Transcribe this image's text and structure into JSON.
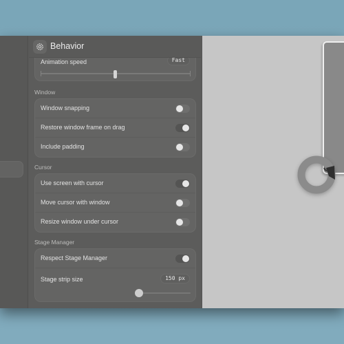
{
  "header": {
    "title": "Behavior",
    "icon": "gear-icon"
  },
  "animation": {
    "label": "Animation speed",
    "value": "Fast",
    "slider_fraction": 0.5
  },
  "sections": [
    {
      "title": "Window",
      "rows": [
        {
          "label": "Window snapping",
          "on": false
        },
        {
          "label": "Restore window frame on drag",
          "on": true
        },
        {
          "label": "Include padding",
          "on": false
        }
      ]
    },
    {
      "title": "Cursor",
      "rows": [
        {
          "label": "Use screen with cursor",
          "on": true
        },
        {
          "label": "Move cursor with window",
          "on": false
        },
        {
          "label": "Resize window under cursor",
          "on": false
        }
      ]
    },
    {
      "title": "Stage Manager",
      "rows": [
        {
          "label": "Respect Stage Manager",
          "on": true
        }
      ],
      "strip": {
        "label": "Stage strip size",
        "value": "150 px",
        "slider_fraction": 0.1
      }
    }
  ]
}
